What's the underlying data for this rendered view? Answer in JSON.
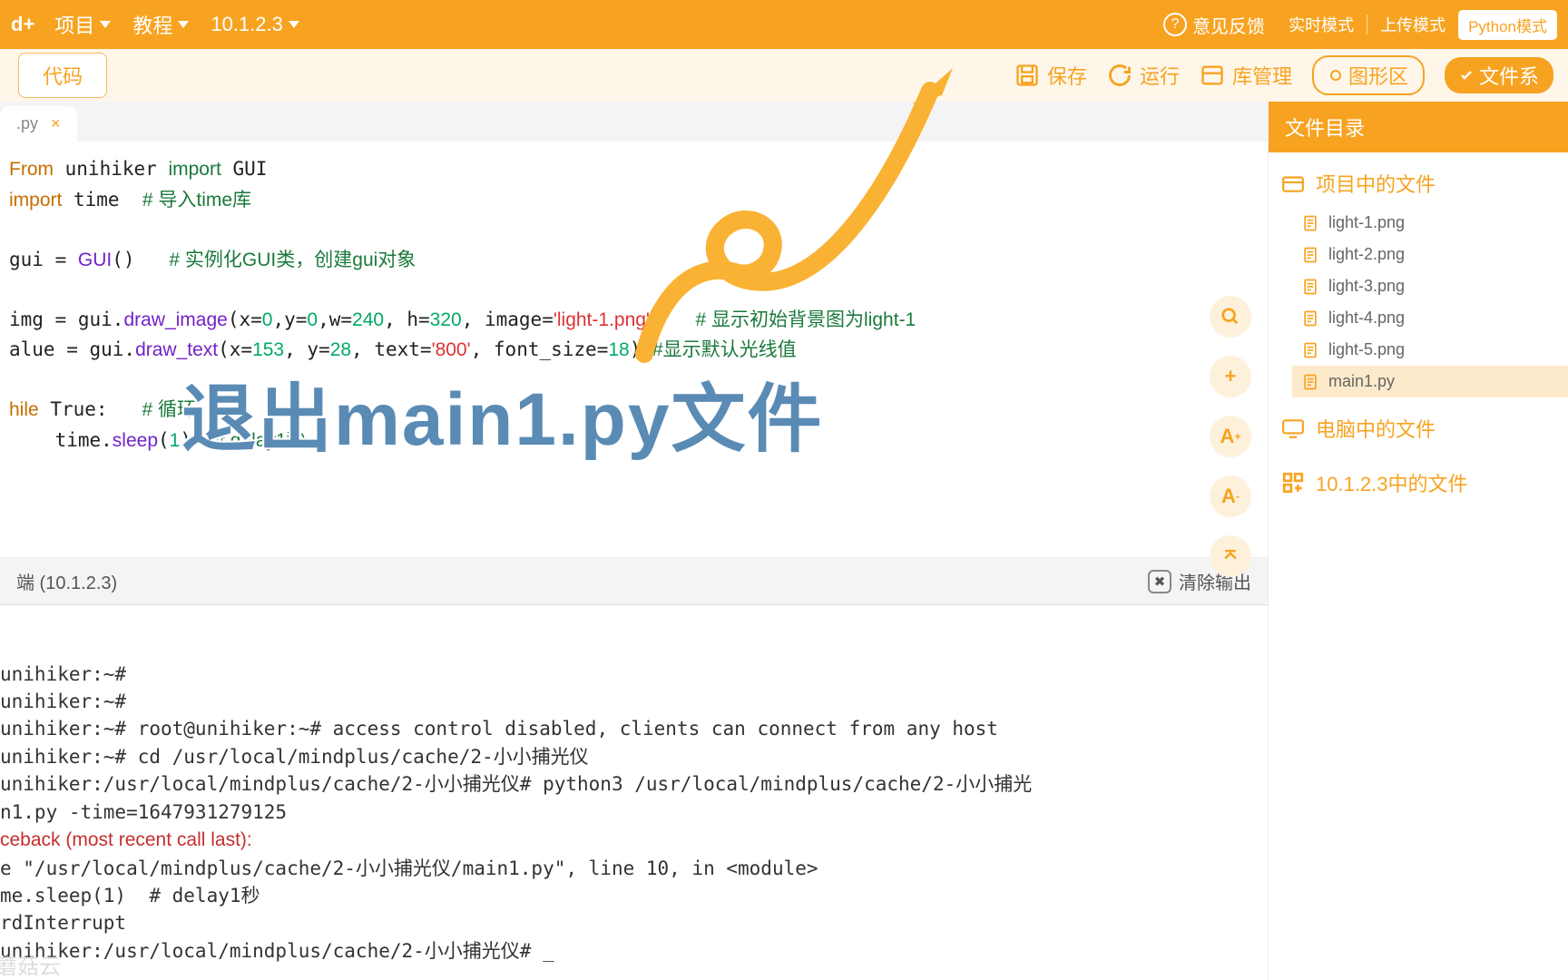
{
  "topbar": {
    "logo": "d+",
    "menu_project": "项目",
    "menu_tutorial": "教程",
    "version": "10.1.2.3",
    "feedback": "意见反馈",
    "mode_realtime": "实时模式",
    "mode_upload": "上传模式",
    "mode_python": "Python模式"
  },
  "toolbar": {
    "code_btn": "代码",
    "save": "保存",
    "run": "运行",
    "lib_mgr": "库管理",
    "graphics": "图形区",
    "files": "文件系"
  },
  "tab": {
    "name": ".py",
    "close": "×"
  },
  "code_lines": [
    {
      "pre": "",
      "kw": "From",
      "mid1": " unihiker ",
      "im": "import",
      "mid2": " GUI",
      "suf": ""
    },
    {
      "pre": "",
      "kw": "import",
      "mid1": " time  ",
      "cm": "# 导入time库"
    },
    {
      "blank": true
    },
    {
      "pre": "gui = ",
      "fn": "GUI",
      "mid1": "()   ",
      "cm": "# 实例化GUI类，创建gui对象"
    },
    {
      "blank": true
    },
    {
      "raw": "img = gui.draw_image(x=0,y=0,w=240, h=320, image='light-1.png')   # 显示初始背景图为light-1"
    },
    {
      "raw": "alue = gui.draw_text(x=153, y=28, text='800', font_size=18) #显示默认光线值"
    },
    {
      "blank": true
    },
    {
      "wh": "hile True:   # 循环"
    },
    {
      "sleep": "    time.sleep(1)  # delay1秒"
    }
  ],
  "side_tools": [
    "🔍",
    "+",
    "A+",
    "A-",
    "⌃"
  ],
  "annotation": "退出main1.py文件",
  "terminal": {
    "header": "端 (10.1.2.3)",
    "clear": "清除输出",
    "lines": [
      "unihiker:~#",
      "unihiker:~#",
      "unihiker:~# root@unihiker:~# access control disabled, clients can connect from any host",
      "unihiker:~# cd /usr/local/mindplus/cache/2-小小捕光仪",
      "unihiker:/usr/local/mindplus/cache/2-小小捕光仪# python3 /usr/local/mindplus/cache/2-小小捕光",
      "n1.py -time=1647931279125",
      "ceback (most recent call last):",
      "e \"/usr/local/mindplus/cache/2-小小捕光仪/main1.py\", line 10, in <module>",
      "me.sleep(1)  # delay1秒",
      "rdInterrupt",
      "unihiker:/usr/local/mindplus/cache/2-小小捕光仪# _"
    ],
    "err_idx": 6
  },
  "sidebar": {
    "title": "文件目录",
    "section_project": "项目中的文件",
    "section_pc": "电脑中的文件",
    "section_device": "10.1.2.3中的文件",
    "files": [
      "light-1.png",
      "light-2.png",
      "light-3.png",
      "light-4.png",
      "light-5.png",
      "main1.py"
    ],
    "selected": "main1.py"
  },
  "watermark": "蘑菇云"
}
